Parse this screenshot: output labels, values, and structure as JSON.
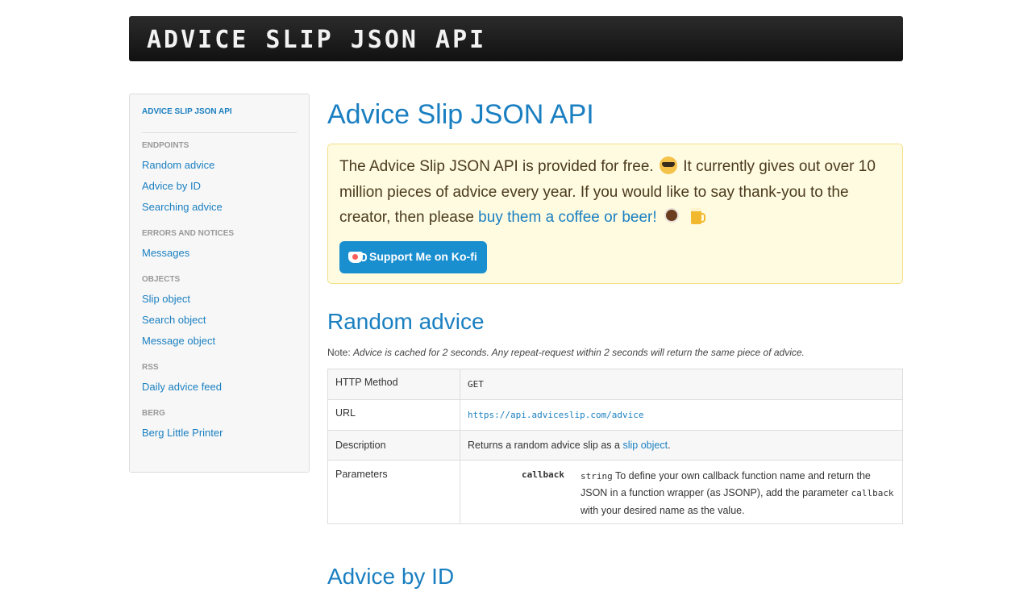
{
  "header": {
    "title": "ADVICE SLIP JSON API"
  },
  "sidebar": {
    "top_link": "ADVICE SLIP JSON API",
    "sections": [
      {
        "heading": "ENDPOINTS",
        "items": [
          "Random advice",
          "Advice by ID",
          "Searching advice"
        ]
      },
      {
        "heading": "ERRORS AND NOTICES",
        "items": [
          "Messages"
        ]
      },
      {
        "heading": "OBJECTS",
        "items": [
          "Slip object",
          "Search object",
          "Message object"
        ]
      },
      {
        "heading": "RSS",
        "items": [
          "Daily advice feed"
        ]
      },
      {
        "heading": "BERG",
        "items": [
          "Berg Little Printer"
        ]
      }
    ]
  },
  "main": {
    "title": "Advice Slip JSON API",
    "notice": {
      "text_1": "The Advice Slip JSON API is provided for free.",
      "text_2": "It currently gives out over 10 million pieces of advice every year. If you would like to say thank-you to the creator, then please",
      "link": "buy them a coffee or beer!",
      "button": "Support Me on Ko-fi"
    },
    "random_advice": {
      "title": "Random advice",
      "note_label": "Note:",
      "note_text": "Advice is cached for 2 seconds. Any repeat-request within 2 seconds will return the same piece of advice.",
      "rows": {
        "method_label": "HTTP Method",
        "method_value": "GET",
        "url_label": "URL",
        "url_value": "https://api.adviceslip.com/advice",
        "desc_label": "Description",
        "desc_text": "Returns a random advice slip as a",
        "desc_link": "slip object",
        "desc_end": ".",
        "params_label": "Parameters",
        "param_name": "callback",
        "param_type": "string",
        "param_desc_1": "To define your own callback function name and return the JSON in a function wrapper (as JSONP), add the parameter",
        "param_code": "callback",
        "param_desc_2": "with your desired name as the value."
      }
    },
    "next_section_title": "Advice by ID"
  }
}
